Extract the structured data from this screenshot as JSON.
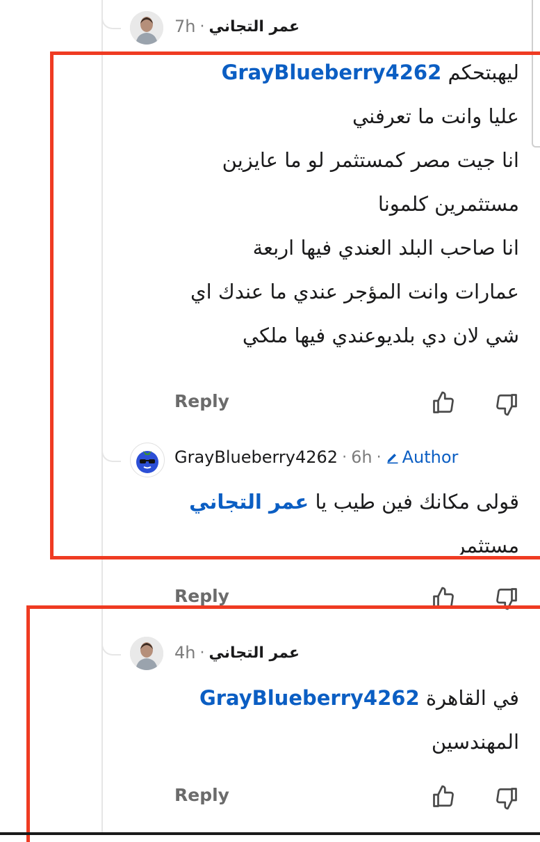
{
  "comments": [
    {
      "author": "عمر التجاني",
      "time": "7h",
      "mention": "GrayBlueberry4262",
      "lines": [
        "ليهبتحكم",
        "عليا وانت ما تعرفني",
        "انا جيت مصر كمستثمر لو ما عايزين",
        "مستثمرين كلمونا",
        "انا صاحب البلد العندي فيها اربعة",
        "عمارات وانت المؤجر عندي ما عندك اي",
        "شي لان دي بلديوعندي فيها ملكي"
      ],
      "reply_label": "Reply"
    },
    {
      "author": "GrayBlueberry4262",
      "time": "6h",
      "flair": "Author",
      "mention": "عمر التجاني",
      "line1": "قولى مكانك فين طيب يا",
      "line2": "مستثمر",
      "reply_label": "Reply"
    },
    {
      "author": "عمر التجاني",
      "time": "4h",
      "mention": "GrayBlueberry4262",
      "line1": "في القاهرة",
      "line2": "المهندسين",
      "reply_label": "Reply"
    }
  ],
  "separator": "·",
  "icons": {
    "upvote": "thumbs-up-icon",
    "downvote": "thumbs-down-icon",
    "author_flair": "pencil-icon"
  },
  "colors": {
    "highlight_box": "#ef3b22",
    "link_blue": "#0b5ec3",
    "muted": "#7c7c7c"
  }
}
